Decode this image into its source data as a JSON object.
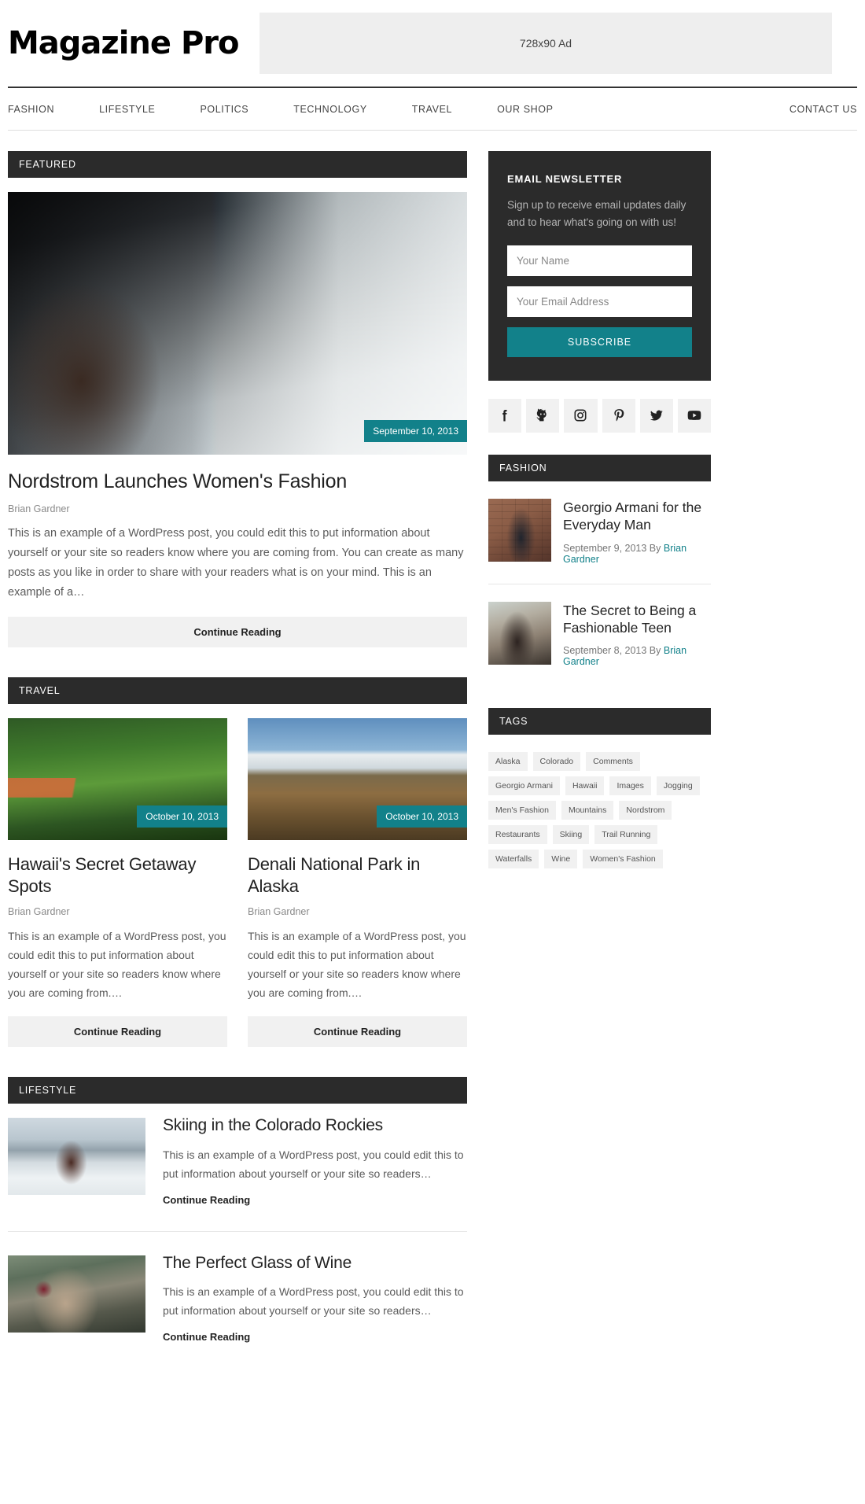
{
  "header": {
    "site_title": "Magazine Pro",
    "ad_label": "728x90 Ad"
  },
  "nav": {
    "left_items": [
      "FASHION",
      "LIFESTYLE",
      "POLITICS",
      "TECHNOLOGY",
      "TRAVEL",
      "OUR SHOP"
    ],
    "right_items": [
      "CONTACT US"
    ]
  },
  "main": {
    "featured": {
      "section_label": "FEATURED",
      "date_badge": "September 10, 2013",
      "title": "Nordstrom Launches Women's Fashion",
      "author": "Brian Gardner",
      "excerpt": "This is an example of a WordPress post, you could edit this to put information about yourself or your site so readers know where you are coming from. You can create as many posts as you like in order to share with your readers what is on your mind. This is an example of a…",
      "more_label": "Continue Reading"
    },
    "travel": {
      "section_label": "TRAVEL",
      "posts": [
        {
          "date_badge": "October 10, 2013",
          "title": "Hawaii's Secret Getaway Spots",
          "author": "Brian Gardner",
          "excerpt": "This is an example of a WordPress post, you could edit this to put information about yourself or your site so readers know where you are coming from.…",
          "more_label": "Continue Reading"
        },
        {
          "date_badge": "October 10, 2013",
          "title": "Denali National Park in Alaska",
          "author": "Brian Gardner",
          "excerpt": "This is an example of a WordPress post, you could edit this to put information about yourself or your site so readers know where you are coming from.…",
          "more_label": "Continue Reading"
        }
      ]
    },
    "lifestyle": {
      "section_label": "LIFESTYLE",
      "posts": [
        {
          "title": "Skiing in the Colorado Rockies",
          "excerpt": "This is an example of a WordPress post, you could edit this to put information about yourself or your site so readers…",
          "more_label": "Continue Reading"
        },
        {
          "title": "The Perfect Glass of Wine",
          "excerpt": "This is an example of a WordPress post, you could edit this to put information about yourself or your site so readers…",
          "more_label": "Continue Reading"
        }
      ]
    }
  },
  "sidebar": {
    "newsletter": {
      "title": "EMAIL NEWSLETTER",
      "description": "Sign up to receive email updates daily and to hear what's going on with us!",
      "name_placeholder": "Your Name",
      "name_value": "",
      "email_placeholder": "Your Email Address",
      "email_value": "",
      "submit_label": "SUBSCRIBE"
    },
    "social": [
      {
        "name": "facebook-icon",
        "label": "Facebook"
      },
      {
        "name": "github-icon",
        "label": "GitHub"
      },
      {
        "name": "instagram-icon",
        "label": "Instagram"
      },
      {
        "name": "pinterest-icon",
        "label": "Pinterest"
      },
      {
        "name": "twitter-icon",
        "label": "Twitter"
      },
      {
        "name": "youtube-icon",
        "label": "YouTube"
      }
    ],
    "fashion": {
      "section_label": "FASHION",
      "posts": [
        {
          "title": "Georgio Armani for the Everyday Man",
          "date": "September 9, 2013 By ",
          "author": "Brian Gardner"
        },
        {
          "title": "The Secret to Being a Fashionable Teen",
          "date": "September 8, 2013 By ",
          "author": "Brian Gardner"
        }
      ]
    },
    "tags": {
      "section_label": "TAGS",
      "items": [
        "Alaska",
        "Colorado",
        "Comments",
        "Georgio Armani",
        "Hawaii",
        "Images",
        "Jogging",
        "Men's Fashion",
        "Mountains",
        "Nordstrom",
        "Restaurants",
        "Skiing",
        "Trail Running",
        "Waterfalls",
        "Wine",
        "Women's Fashion"
      ]
    }
  },
  "colors": {
    "accent": "#12818a",
    "dark_bar": "#2b2b2b",
    "light_bg": "#f1f1f1"
  }
}
